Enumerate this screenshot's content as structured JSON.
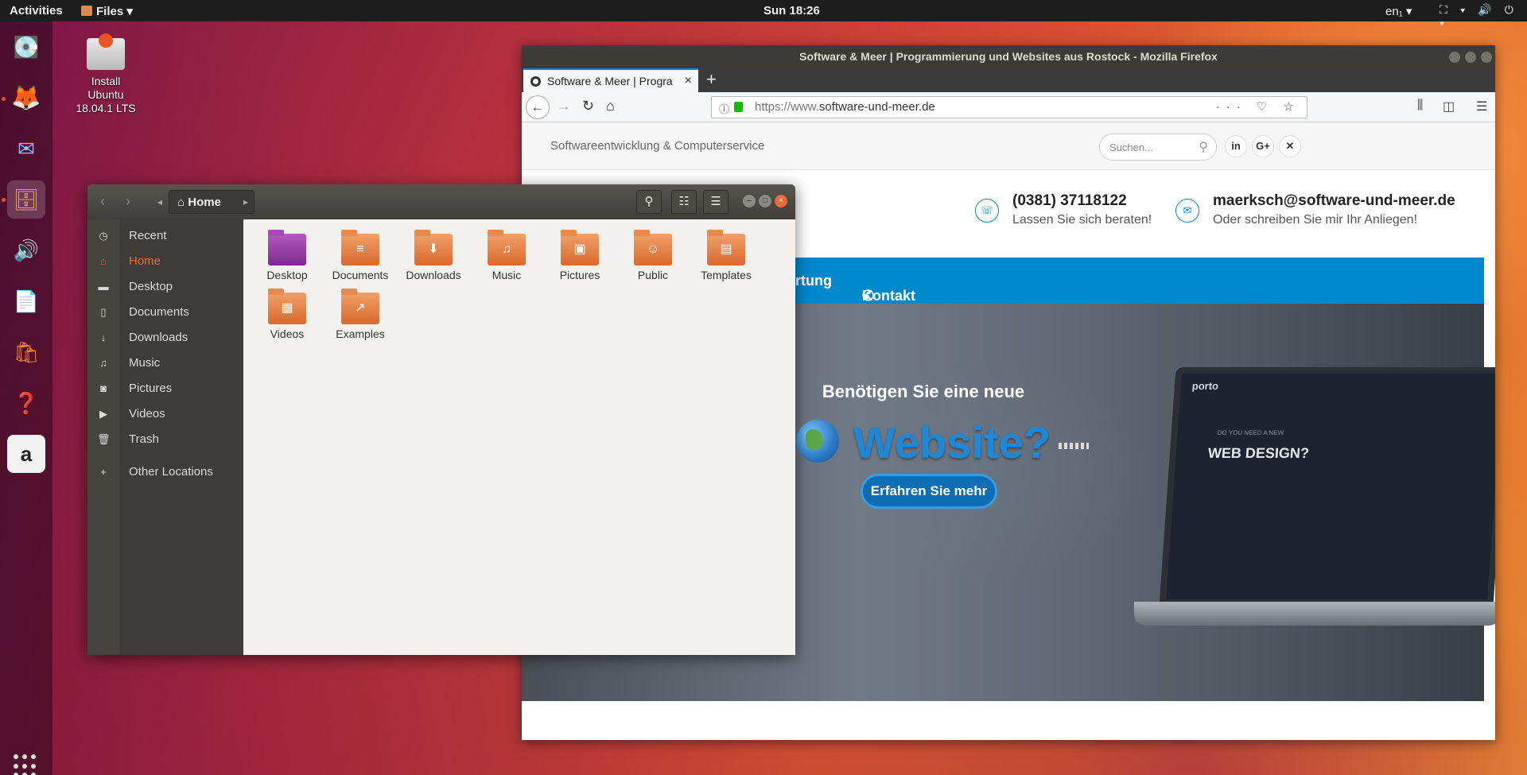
{
  "topbar": {
    "activities": "Activities",
    "app_menu": "Files ▾",
    "clock": "Sun 18:26",
    "lang": "en₁ ▾",
    "tray": "⛶ ▾ 🔊 ⏻ ▾"
  },
  "desktop_icon": {
    "line1": "Install",
    "line2": "Ubuntu",
    "line3": "18.04.1 LTS"
  },
  "dock": {
    "apps": [
      "install-ubuntu",
      "firefox",
      "thunderbird",
      "files",
      "rhythmbox",
      "libreoffice-writer",
      "ubuntu-software",
      "help",
      "amazon"
    ],
    "active": "files"
  },
  "firefox": {
    "title": "Software & Meer | Programmierung und Websites aus Rostock - Mozilla Firefox",
    "tab_title": "Software & Meer | Progra",
    "new_tab": "+",
    "url_prefix": "https://www.",
    "url_domain": "software-und-meer.de",
    "url_actions": "··· ♡ ☆",
    "page": {
      "tagline": "Softwareentwicklung & Computerservice",
      "search_placeholder": "Suchen...",
      "social": [
        "in",
        "G+",
        "✕"
      ],
      "phone": "(0381) 37118122",
      "phone_sub": "Lassen Sie sich beraten!",
      "email": "maerksch@software-und-meer.de",
      "email_sub": "Oder schreiben Sie mir Ihr Anliegen!",
      "menu_wartung": "rtung",
      "menu_kontakt": "Kontakt",
      "hero_line1": "Benötigen Sie eine neue",
      "hero_line2": "Website?",
      "hero_button": "Erfahren Sie mehr",
      "laptop_small": "DO YOU NEED A NEW",
      "laptop_big": "WEB DESIGN?",
      "laptop_logo": "porto"
    }
  },
  "files": {
    "path": "Home",
    "sidebar": [
      {
        "label": "Recent",
        "icon": "◷"
      },
      {
        "label": "Home",
        "icon": "⌂",
        "selected": true
      },
      {
        "label": "Desktop",
        "icon": "▬"
      },
      {
        "label": "Documents",
        "icon": "▯"
      },
      {
        "label": "Downloads",
        "icon": "↓"
      },
      {
        "label": "Music",
        "icon": "♫"
      },
      {
        "label": "Pictures",
        "icon": "◙"
      },
      {
        "label": "Videos",
        "icon": "▶"
      },
      {
        "label": "Trash",
        "icon": "🗑"
      },
      {
        "label": "Other Locations",
        "icon": "+"
      }
    ],
    "folders": [
      {
        "label": "Desktop",
        "glyph": ""
      },
      {
        "label": "Documents",
        "glyph": "≡"
      },
      {
        "label": "Downloads",
        "glyph": "⬇"
      },
      {
        "label": "Music",
        "glyph": "♫"
      },
      {
        "label": "Pictures",
        "glyph": "▣"
      },
      {
        "label": "Public",
        "glyph": "☺"
      },
      {
        "label": "Templates",
        "glyph": "▤"
      },
      {
        "label": "Videos",
        "glyph": "▦"
      },
      {
        "label": "Examples",
        "glyph": "↗"
      }
    ]
  }
}
